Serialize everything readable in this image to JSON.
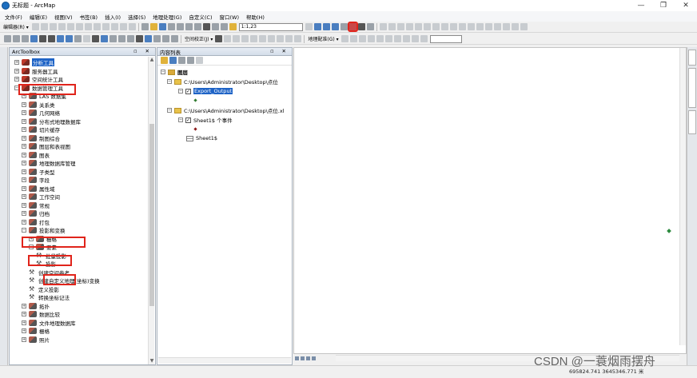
{
  "window": {
    "title": "无标题 - ArcMap",
    "minimize": "—",
    "restore": "❐",
    "close": "✕"
  },
  "menu": [
    "文件(F)",
    "编辑(E)",
    "视图(V)",
    "书签(B)",
    "插入(I)",
    "选择(S)",
    "地理处理(G)",
    "自定义(C)",
    "窗口(W)",
    "帮助(H)"
  ],
  "toolbar1": {
    "editor_label": "编辑器(R) ▾",
    "scale_value": "1:1,23"
  },
  "toolbar2": {
    "spatial_adjust_label": "空间校正(J) ▾",
    "georef_label": "地理配准(G) ▾"
  },
  "arctoolbox": {
    "title": "ArcToolbox",
    "items": [
      {
        "label": "分析工具",
        "expander": "⊞",
        "icon": "toolbox",
        "level": 0,
        "selected": true
      },
      {
        "label": "服务器工具",
        "expander": "⊞",
        "icon": "toolbox",
        "level": 0
      },
      {
        "label": "空间统计工具",
        "expander": "⊞",
        "icon": "toolbox",
        "level": 0
      },
      {
        "label": "数据管理工具",
        "expander": "⊟",
        "icon": "toolbox",
        "level": 0
      },
      {
        "label": "LAS 数据集",
        "expander": "⊞",
        "icon": "toolset",
        "level": 1
      },
      {
        "label": "关系类",
        "expander": "⊞",
        "icon": "toolset",
        "level": 1
      },
      {
        "label": "几何网络",
        "expander": "⊞",
        "icon": "toolset",
        "level": 1
      },
      {
        "label": "分布式地理数据库",
        "expander": "⊞",
        "icon": "toolset",
        "level": 1
      },
      {
        "label": "切片缓存",
        "expander": "⊞",
        "icon": "toolset",
        "level": 1
      },
      {
        "label": "制图综合",
        "expander": "⊞",
        "icon": "toolset",
        "level": 1
      },
      {
        "label": "图层和表视图",
        "expander": "⊞",
        "icon": "toolset",
        "level": 1
      },
      {
        "label": "图表",
        "expander": "⊞",
        "icon": "toolset",
        "level": 1
      },
      {
        "label": "地理数据库管理",
        "expander": "⊞",
        "icon": "toolset",
        "level": 1
      },
      {
        "label": "子类型",
        "expander": "⊞",
        "icon": "toolset",
        "level": 1
      },
      {
        "label": "字段",
        "expander": "⊞",
        "icon": "toolset",
        "level": 1
      },
      {
        "label": "属性域",
        "expander": "⊞",
        "icon": "toolset",
        "level": 1
      },
      {
        "label": "工作空间",
        "expander": "⊞",
        "icon": "toolset",
        "level": 1
      },
      {
        "label": "常规",
        "expander": "⊞",
        "icon": "toolset",
        "level": 1
      },
      {
        "label": "归档",
        "expander": "⊞",
        "icon": "toolset",
        "level": 1
      },
      {
        "label": "打包",
        "expander": "⊞",
        "icon": "toolset",
        "level": 1
      },
      {
        "label": "投影和变换",
        "expander": "⊟",
        "icon": "toolset",
        "level": 1
      },
      {
        "label": "栅格",
        "expander": "⊞",
        "icon": "toolset",
        "level": 2
      },
      {
        "label": "要素",
        "expander": "⊟",
        "icon": "toolset",
        "level": 2
      },
      {
        "label": "批量投影",
        "expander": "",
        "icon": "tool",
        "level": 3
      },
      {
        "label": "投影",
        "expander": "",
        "icon": "tool",
        "level": 3
      },
      {
        "label": "创建空间参考",
        "expander": "",
        "icon": "tool",
        "level": 2
      },
      {
        "label": "创建自定义地理(坐标)变换",
        "expander": "",
        "icon": "tool",
        "level": 2
      },
      {
        "label": "定义投影",
        "expander": "",
        "icon": "tool",
        "level": 2
      },
      {
        "label": "转换坐标记法",
        "expander": "",
        "icon": "tool",
        "level": 2
      },
      {
        "label": "拓扑",
        "expander": "⊞",
        "icon": "toolset",
        "level": 1
      },
      {
        "label": "数据比较",
        "expander": "⊞",
        "icon": "toolset",
        "level": 1
      },
      {
        "label": "文件地理数据库",
        "expander": "⊞",
        "icon": "toolset",
        "level": 1
      },
      {
        "label": "栅格",
        "expander": "⊞",
        "icon": "toolset",
        "level": 1
      },
      {
        "label": "照片",
        "expander": "⊞",
        "icon": "toolset",
        "level": 1
      }
    ]
  },
  "toc": {
    "title": "内容列表",
    "root": "图层",
    "folder1": "C:\\Users\\Administrator\\Desktop\\点位",
    "layer1": "Export_Output",
    "folder2": "C:\\Users\\Administrator\\Desktop\\点位.xl",
    "layer2": "Sheet1$ 个事件",
    "table1": "Sheet1$"
  },
  "panel_controls": "▫ ✕",
  "status": {
    "coordinates": "695824.741  3645346.771 米"
  },
  "watermark": "CSDN @一蓑烟雨摆舟"
}
